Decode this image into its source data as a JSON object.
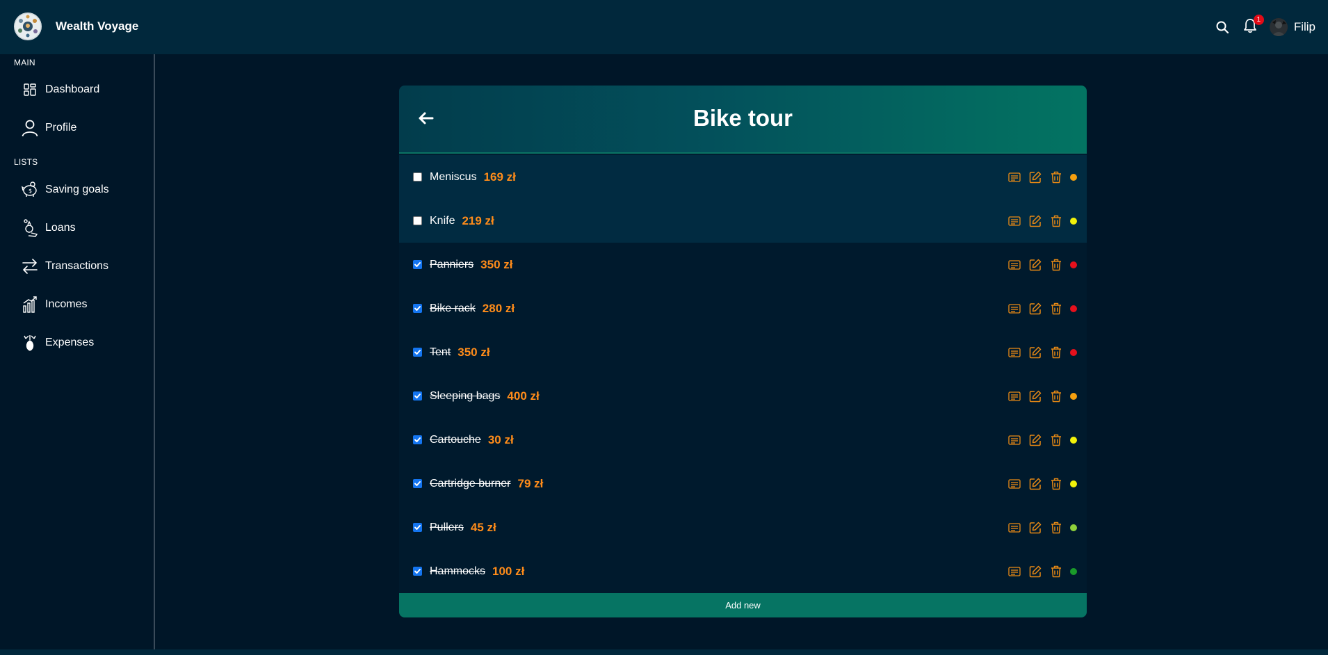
{
  "app": {
    "name": "Wealth Voyage"
  },
  "header": {
    "notifications_count": "1",
    "user_name": "Filip"
  },
  "sidebar": {
    "section_main": "MAIN",
    "section_lists": "LISTS",
    "items": [
      {
        "label": "Dashboard",
        "icon": "dashboard-icon"
      },
      {
        "label": "Profile",
        "icon": "user-icon"
      },
      {
        "label": "Saving goals",
        "icon": "piggy-bank-icon"
      },
      {
        "label": "Loans",
        "icon": "loan-icon"
      },
      {
        "label": "Transactions",
        "icon": "transfer-arrows-icon"
      },
      {
        "label": "Incomes",
        "icon": "bar-chart-icon"
      },
      {
        "label": "Expenses",
        "icon": "money-bag-icon"
      }
    ]
  },
  "list": {
    "title": "Bike tour",
    "add_label": "Add new",
    "items": [
      {
        "name": "Meniscus",
        "price": "169 zł",
        "checked": false,
        "priority_color": "#f5a00f"
      },
      {
        "name": "Knife",
        "price": "219 zł",
        "checked": false,
        "priority_color": "#f2f20a"
      },
      {
        "name": "Panniers",
        "price": "350 zł",
        "checked": true,
        "priority_color": "#e6101c"
      },
      {
        "name": "Bike rack",
        "price": "280 zł",
        "checked": true,
        "priority_color": "#e6101c"
      },
      {
        "name": "Tent",
        "price": "350 zł",
        "checked": true,
        "priority_color": "#e6101c"
      },
      {
        "name": "Sleeping bags",
        "price": "400 zł",
        "checked": true,
        "priority_color": "#f5a00f"
      },
      {
        "name": "Cartouche",
        "price": "30 zł",
        "checked": true,
        "priority_color": "#f2f20a"
      },
      {
        "name": "Cartridge burner",
        "price": "79 zł",
        "checked": true,
        "priority_color": "#f2f20a"
      },
      {
        "name": "Pullers",
        "price": "45 zł",
        "checked": true,
        "priority_color": "#8fd13b"
      },
      {
        "name": "Hammocks",
        "price": "100 zł",
        "checked": true,
        "priority_color": "#1a9b2a"
      }
    ]
  },
  "colors": {
    "accent": "#067463",
    "price": "#ff8c1a",
    "icon_orange": "#e98a15",
    "checkbox": "#1475f0"
  }
}
